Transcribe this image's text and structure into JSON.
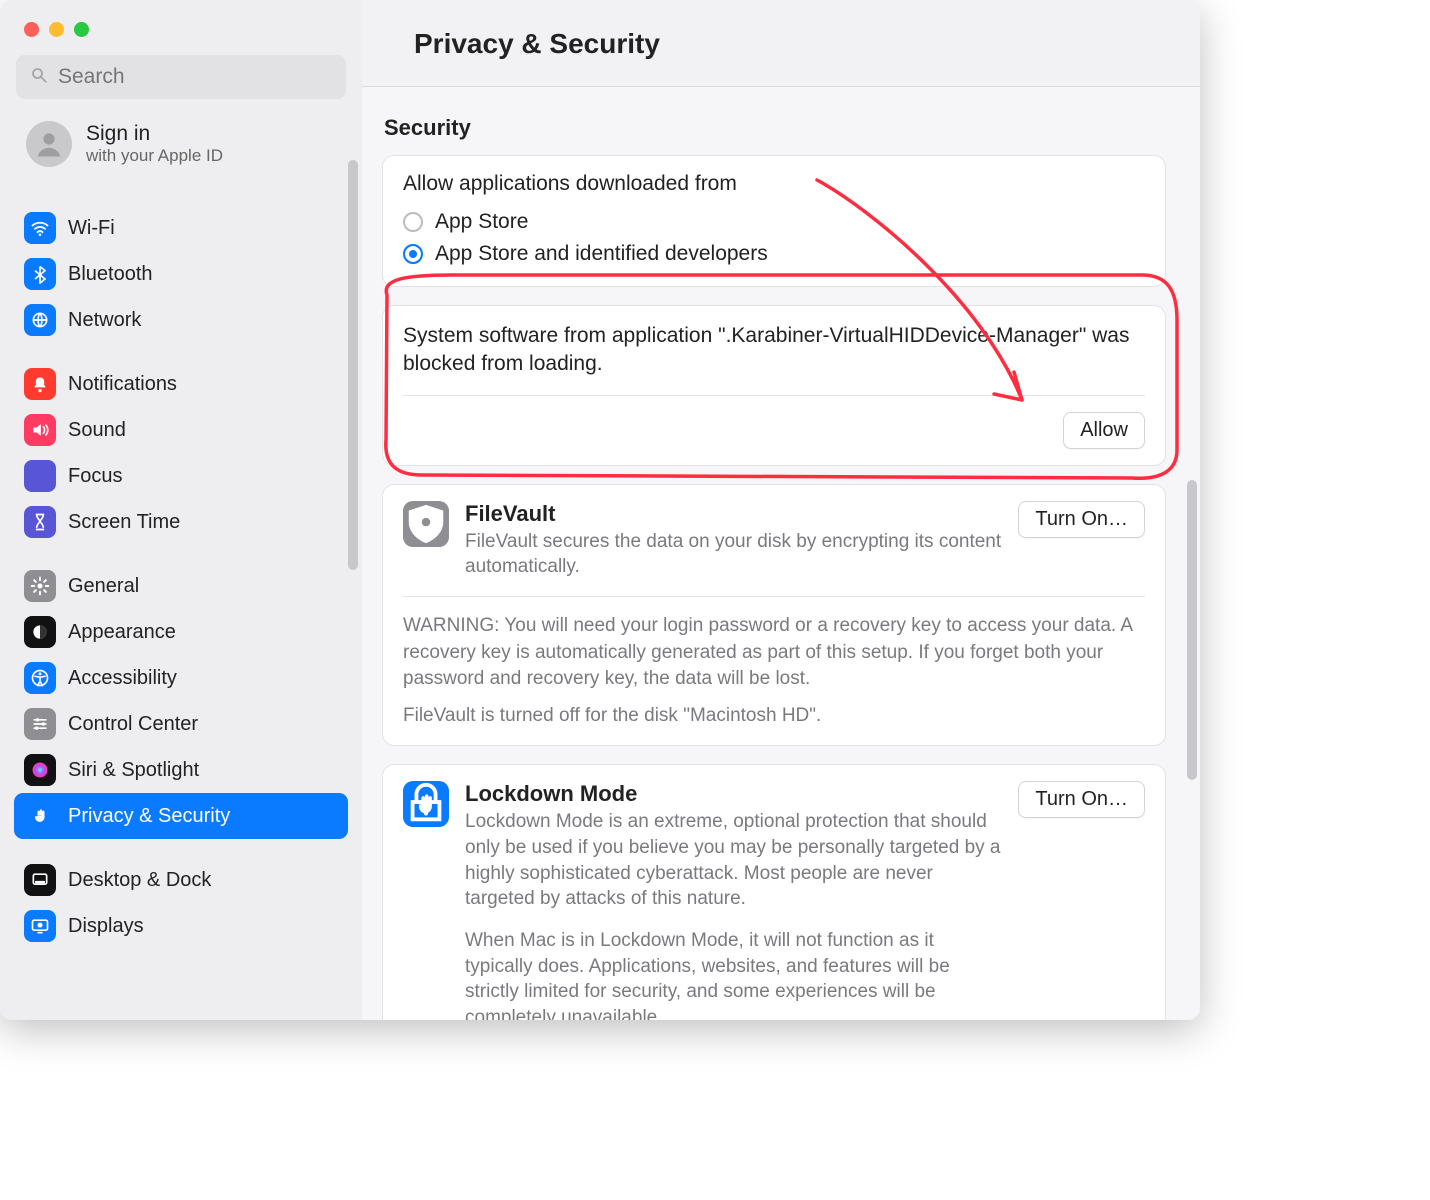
{
  "window": {
    "title": "Privacy & Security"
  },
  "search": {
    "placeholder": "Search"
  },
  "signin": {
    "title": "Sign in",
    "subtitle": "with your Apple ID"
  },
  "sidebar": {
    "groups": [
      {
        "items": [
          {
            "label": "Wi-Fi",
            "icon": "wifi",
            "color": "#0a7aff"
          },
          {
            "label": "Bluetooth",
            "icon": "bluetooth",
            "color": "#0a7aff"
          },
          {
            "label": "Network",
            "icon": "globe",
            "color": "#0a7aff"
          }
        ]
      },
      {
        "items": [
          {
            "label": "Notifications",
            "icon": "bell",
            "color": "#ff3b30"
          },
          {
            "label": "Sound",
            "icon": "speaker",
            "color": "#ff3b63"
          },
          {
            "label": "Focus",
            "icon": "moon",
            "color": "#5856d6"
          },
          {
            "label": "Screen Time",
            "icon": "hourglass",
            "color": "#5856d6"
          }
        ]
      },
      {
        "items": [
          {
            "label": "General",
            "icon": "gear",
            "color": "#8e8e93"
          },
          {
            "label": "Appearance",
            "icon": "appearance",
            "color": "#111"
          },
          {
            "label": "Accessibility",
            "icon": "accessibility",
            "color": "#0a7aff"
          },
          {
            "label": "Control Center",
            "icon": "sliders",
            "color": "#8e8e93"
          },
          {
            "label": "Siri & Spotlight",
            "icon": "siri",
            "color": "#111"
          },
          {
            "label": "Privacy & Security",
            "icon": "hand",
            "color": "#0a7aff",
            "selected": true
          }
        ]
      },
      {
        "items": [
          {
            "label": "Desktop & Dock",
            "icon": "dock",
            "color": "#111"
          },
          {
            "label": "Displays",
            "icon": "display",
            "color": "#0a7aff"
          }
        ]
      }
    ]
  },
  "security": {
    "heading": "Security",
    "allow_label": "Allow applications downloaded from",
    "options": [
      {
        "label": "App Store",
        "checked": false
      },
      {
        "label": "App Store and identified developers",
        "checked": true
      }
    ],
    "blocked_msg": "System software from application \".Karabiner-VirtualHIDDevice-Manager\" was blocked from loading.",
    "allow_button": "Allow"
  },
  "filevault": {
    "title": "FileVault",
    "desc": "FileVault secures the data on your disk by encrypting its content automatically.",
    "button": "Turn On…",
    "warning": "WARNING: You will need your login password or a recovery key to access your data. A recovery key is automatically generated as part of this setup. If you forget both your password and recovery key, the data will be lost.",
    "status": "FileVault is turned off for the disk \"Macintosh HD\"."
  },
  "lockdown": {
    "title": "Lockdown Mode",
    "desc": "Lockdown Mode is an extreme, optional protection that should only be used if you believe you may be personally targeted by a highly sophisticated cyberattack. Most people are never targeted by attacks of this nature.",
    "desc2": "When Mac is in Lockdown Mode, it will not function as it typically does. Applications, websites, and features will be strictly limited for security, and some experiences will be completely unavailable.",
    "button": "Turn On…"
  }
}
